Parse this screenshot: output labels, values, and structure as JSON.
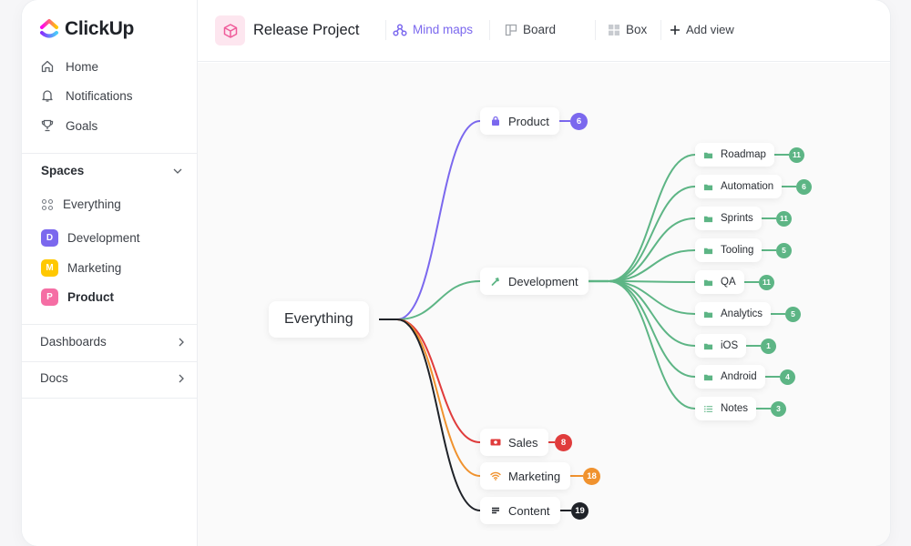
{
  "app": {
    "name": "ClickUp"
  },
  "sidebar": {
    "nav": [
      {
        "label": "Home",
        "icon": "home-icon"
      },
      {
        "label": "Notifications",
        "icon": "bell-icon"
      },
      {
        "label": "Goals",
        "icon": "trophy-icon"
      }
    ],
    "spaces_title": "Spaces",
    "everything_label": "Everything",
    "spaces": [
      {
        "letter": "D",
        "label": "Development",
        "color": "#7b68ee"
      },
      {
        "letter": "M",
        "label": "Marketing",
        "color": "#ffc800"
      },
      {
        "label": "Product",
        "letter": "P",
        "color": "#f56ea4"
      }
    ],
    "links": [
      {
        "label": "Dashboards"
      },
      {
        "label": "Docs"
      }
    ]
  },
  "header": {
    "project_title": "Release Project",
    "tabs": [
      {
        "label": "Mind maps",
        "icon": "mindmap-icon",
        "active": true
      },
      {
        "label": "Board",
        "icon": "board-icon",
        "active": false
      },
      {
        "label": "Box",
        "icon": "box-grid-icon",
        "active": false
      }
    ],
    "add_view_label": "Add view"
  },
  "mindmap": {
    "root": {
      "label": "Everything"
    },
    "branches": [
      {
        "label": "Product",
        "icon": "bag-icon",
        "color": "#7b68ee",
        "count": "6"
      },
      {
        "label": "Development",
        "icon": "hammer-icon",
        "color": "#5db585",
        "count": null,
        "children": [
          {
            "label": "Roadmap",
            "icon": "folder-icon",
            "count": "11"
          },
          {
            "label": "Automation",
            "icon": "folder-icon",
            "count": "6"
          },
          {
            "label": "Sprints",
            "icon": "folder-icon",
            "count": "11"
          },
          {
            "label": "Tooling",
            "icon": "folder-icon",
            "count": "5"
          },
          {
            "label": "QA",
            "icon": "folder-icon",
            "count": "11"
          },
          {
            "label": "Analytics",
            "icon": "folder-icon",
            "count": "5"
          },
          {
            "label": "iOS",
            "icon": "folder-icon",
            "count": "1"
          },
          {
            "label": "Android",
            "icon": "folder-icon",
            "count": "4"
          },
          {
            "label": "Notes",
            "icon": "list-icon",
            "count": "3"
          }
        ]
      },
      {
        "label": "Sales",
        "icon": "money-icon",
        "color": "#e03c3c",
        "count": "8"
      },
      {
        "label": "Marketing",
        "icon": "wifi-icon",
        "color": "#f0922e",
        "count": "18"
      },
      {
        "label": "Content",
        "icon": "lines-icon",
        "color": "#1f2228",
        "count": "19"
      }
    ]
  }
}
